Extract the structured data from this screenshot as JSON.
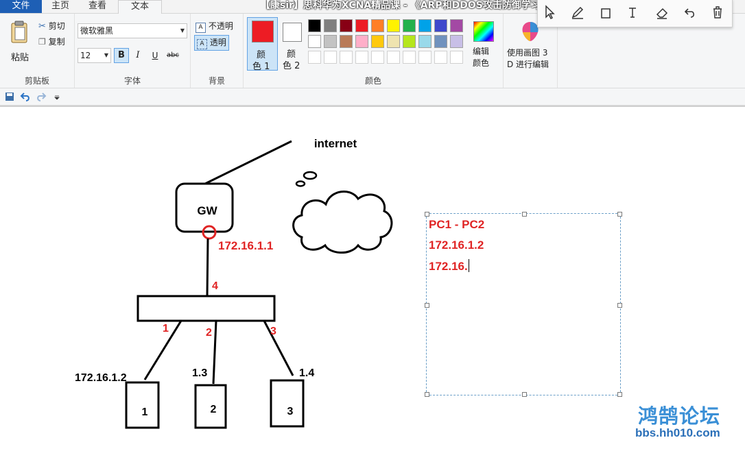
{
  "tabs": [
    {
      "label": "文件"
    },
    {
      "label": "主页"
    },
    {
      "label": "查看"
    },
    {
      "label": "文本"
    }
  ],
  "video_title": "【康sir】思科华为XCNA精品课 - 《ARP和DDOS攻击防御学习》.mp4",
  "clipboard": {
    "paste": "粘贴",
    "cut": "剪切",
    "copy": "复制",
    "group_label": "剪贴板"
  },
  "font": {
    "family": "微软雅黑",
    "size": "12",
    "bold": "B",
    "italic": "I",
    "underline": "U",
    "strike": "abc",
    "group_label": "字体"
  },
  "background": {
    "opaque": "不透明",
    "transparent": "透明",
    "group_label": "背景"
  },
  "colors": {
    "color1_line1": "颜",
    "color1_line2": "色 1",
    "color2_line1": "颜",
    "color2_line2": "色 2",
    "edit_line1": "编辑",
    "edit_line2": "颜色",
    "group_label": "颜色",
    "color1_value": "#ed1c24",
    "color2_value": "#ffffff",
    "palette": [
      "#000000",
      "#7f7f7f",
      "#880015",
      "#ed1c24",
      "#ff7f27",
      "#fff200",
      "#22b14c",
      "#00a2e8",
      "#3f48cc",
      "#a349a4",
      "#ffffff",
      "#c3c3c3",
      "#b97a57",
      "#ffaec9",
      "#ffc90e",
      "#efe4b0",
      "#b5e61d",
      "#99d9ea",
      "#7092be",
      "#c8bfe7"
    ]
  },
  "paint3d": {
    "line1": "使用画图 3",
    "line2": "D 进行编辑"
  },
  "diagram": {
    "cloud_label": "internet",
    "gateway_label": "GW",
    "gateway_ip": "172.16.1.1",
    "uplink_port": "4",
    "ports": [
      "1",
      "2",
      "3"
    ],
    "hosts": [
      {
        "label": "1",
        "ip": "172.16.1.2"
      },
      {
        "label": "2",
        "ip": "1.3"
      },
      {
        "label": "3",
        "ip": "1.4"
      }
    ]
  },
  "textbox": {
    "lines": [
      "PC1 - PC2",
      "172.16.1.2",
      "172.16."
    ]
  },
  "watermark": {
    "name": "鸿鹄论坛",
    "url": "bbs.hh010.com"
  }
}
